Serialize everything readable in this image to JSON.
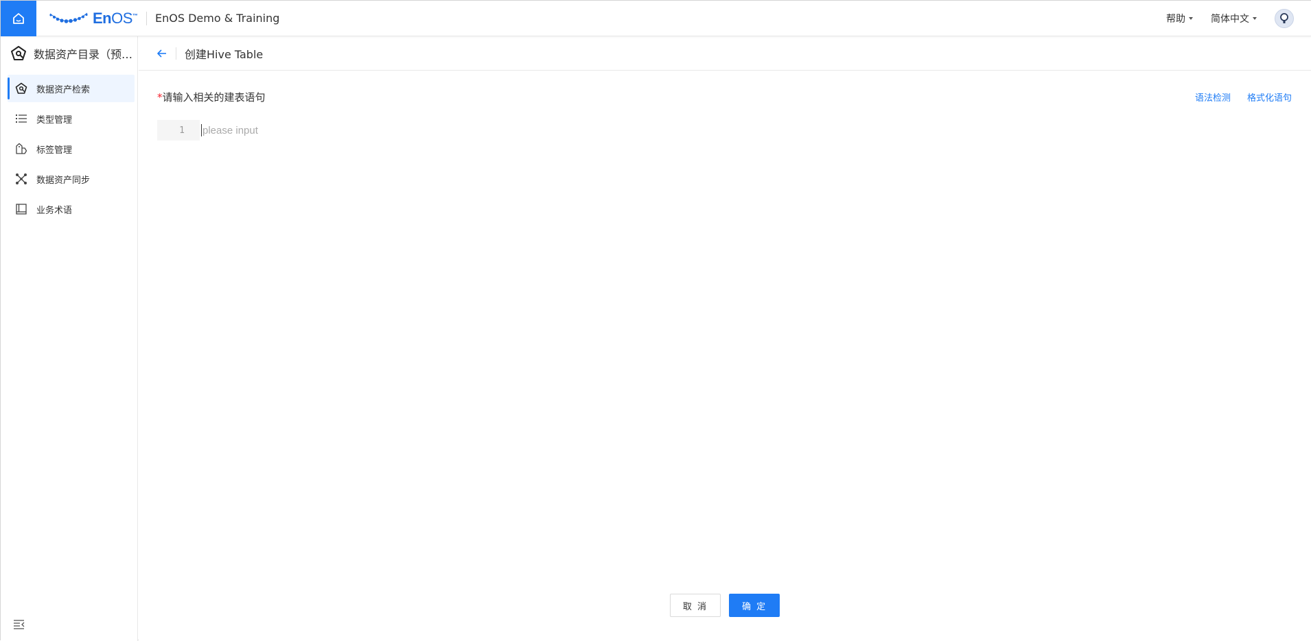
{
  "topbar": {
    "logo_text_en": "En",
    "logo_text_os": "OS",
    "logo_tm": "™",
    "app_name": "EnOS Demo & Training",
    "help_label": "帮助",
    "language_label": "简体中文"
  },
  "sidebar": {
    "title": "数据资产目录（预览版）",
    "items": [
      {
        "label": "数据资产检索",
        "icon": "asset-search-icon",
        "active": true
      },
      {
        "label": "类型管理",
        "icon": "list-icon",
        "active": false
      },
      {
        "label": "标签管理",
        "icon": "tag-icon",
        "active": false
      },
      {
        "label": "数据资产同步",
        "icon": "sync-nodes-icon",
        "active": false
      },
      {
        "label": "业务术语",
        "icon": "book-icon",
        "active": false
      }
    ]
  },
  "page": {
    "title": "创建Hive Table",
    "field_required_mark": "*",
    "field_label": "请输入相关的建表语句",
    "syntax_check_label": "语法检测",
    "format_label": "格式化语句",
    "editor": {
      "line_number": "1",
      "placeholder": "please input",
      "value": ""
    },
    "cancel_label": "取 消",
    "confirm_label": "确 定"
  },
  "colors": {
    "accent": "#1f7cf5",
    "active_bg": "#eef5ff",
    "required": "#f5222d"
  }
}
